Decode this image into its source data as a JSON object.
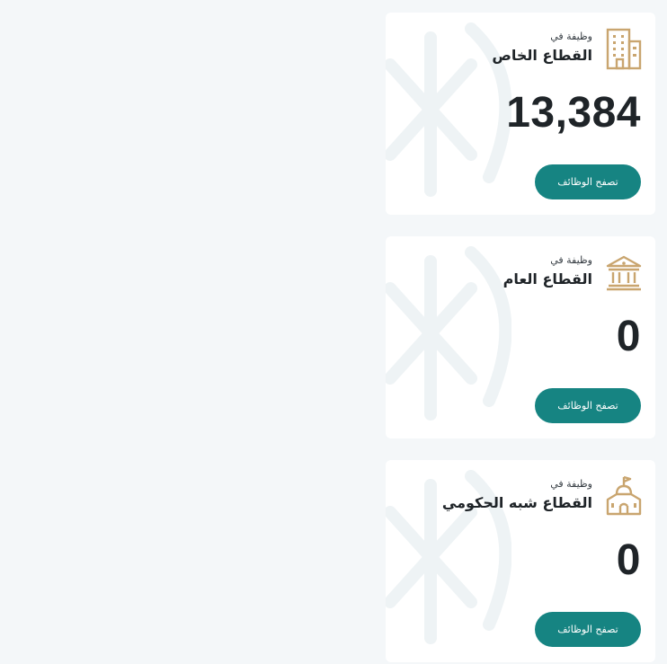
{
  "colors": {
    "background": "#f4f7f9",
    "card": "#ffffff",
    "accent": "#168482",
    "icon_gold": "#c9a56f",
    "text_dark": "#1f2428"
  },
  "cards": [
    {
      "icon": "office-building-icon",
      "prefix": "وظيفة في",
      "sector": "القطاع الخاص",
      "count": "13,384",
      "button_label": "تصفح الوظائف"
    },
    {
      "icon": "government-building-icon",
      "prefix": "وظيفة في",
      "sector": "القطاع العام",
      "count": "0",
      "button_label": "تصفح الوظائف"
    },
    {
      "icon": "semi-government-building-icon",
      "prefix": "وظيفة في",
      "sector": "القطاع شبه الحكومي",
      "count": "0",
      "button_label": "تصفح الوظائف"
    }
  ]
}
